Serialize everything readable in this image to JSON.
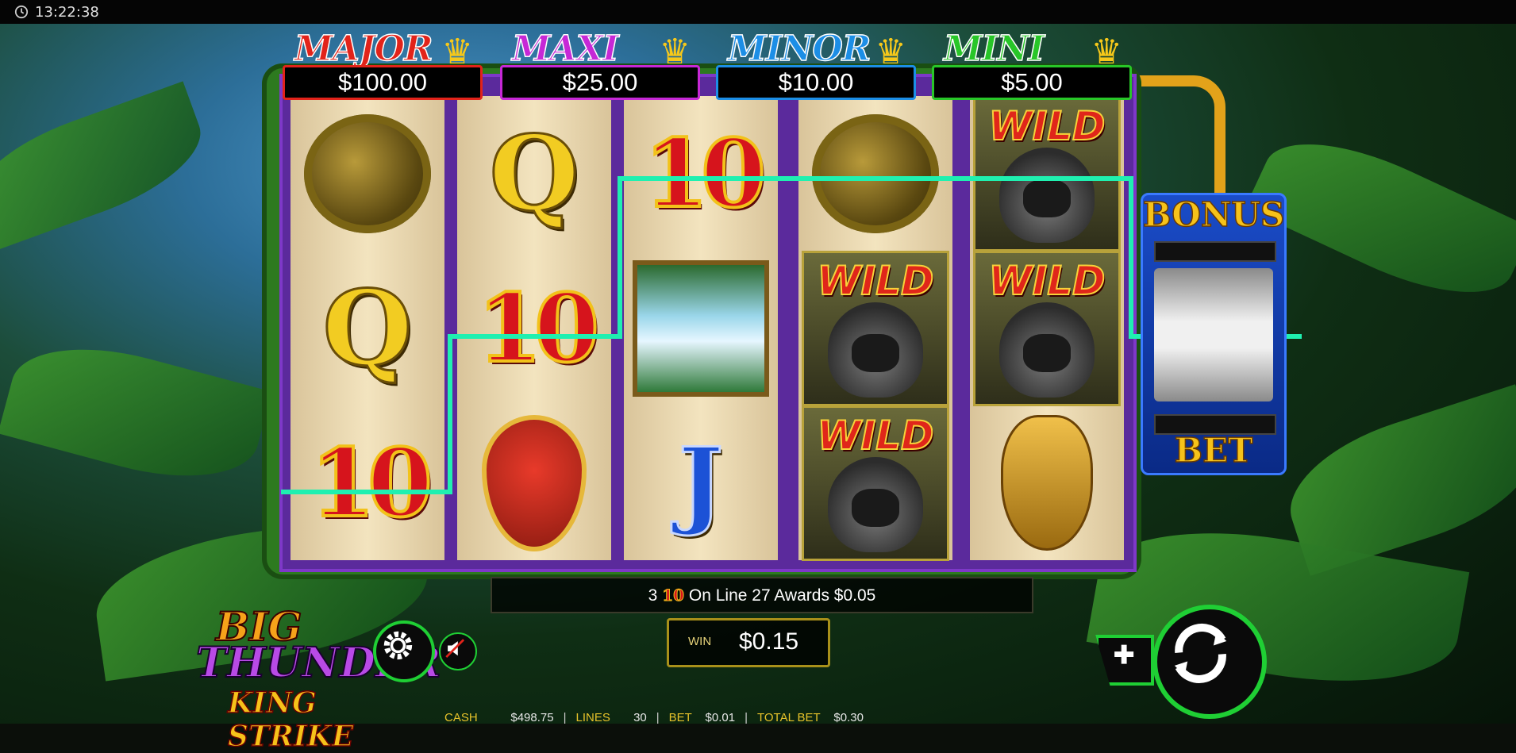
{
  "status_bar": {
    "time": "13:22:38"
  },
  "jackpots": [
    {
      "name": "MAJOR",
      "value": "$100.00",
      "color": "#e2231a"
    },
    {
      "name": "MAXI",
      "value": "$25.00",
      "color": "#c628d6"
    },
    {
      "name": "MINOR",
      "value": "$10.00",
      "color": "#1c8ee6"
    },
    {
      "name": "MINI",
      "value": "$5.00",
      "color": "#28c628"
    }
  ],
  "reels": [
    [
      "snake",
      "Q",
      "10"
    ],
    [
      "Q",
      "10",
      "shield"
    ],
    [
      "10",
      "waterfall",
      "J"
    ],
    [
      "snake",
      "WILD",
      "WILD"
    ],
    [
      "WILD",
      "WILD",
      "mask"
    ]
  ],
  "wild_label": "WILD",
  "bonus_meter": {
    "title": "BONUS",
    "bet_label": "BET"
  },
  "message": {
    "prefix": "3",
    "symbol": "10",
    "text": "On Line 27 Awards $0.05"
  },
  "win": {
    "label": "WIN",
    "value": "$0.15"
  },
  "logo": {
    "line1": "BIG",
    "line2": "THUNDER",
    "line3": "KING STRIKE"
  },
  "bottom_bar": {
    "cash_label": "CASH",
    "cash_value": "$498.75",
    "lines_label": "LINES",
    "lines_value": "30",
    "bet_label": "BET",
    "bet_value": "$0.01",
    "total_bet_label": "TOTAL BET",
    "total_bet_value": "$0.30"
  },
  "icons": [
    "clock-icon",
    "gear-icon",
    "sound-muted-icon",
    "plus-icon",
    "spin-icon"
  ],
  "colors": {
    "win_line": "#1ff0b0",
    "button_accent": "#1fcf34",
    "reel_frame": "#7e38c8"
  }
}
